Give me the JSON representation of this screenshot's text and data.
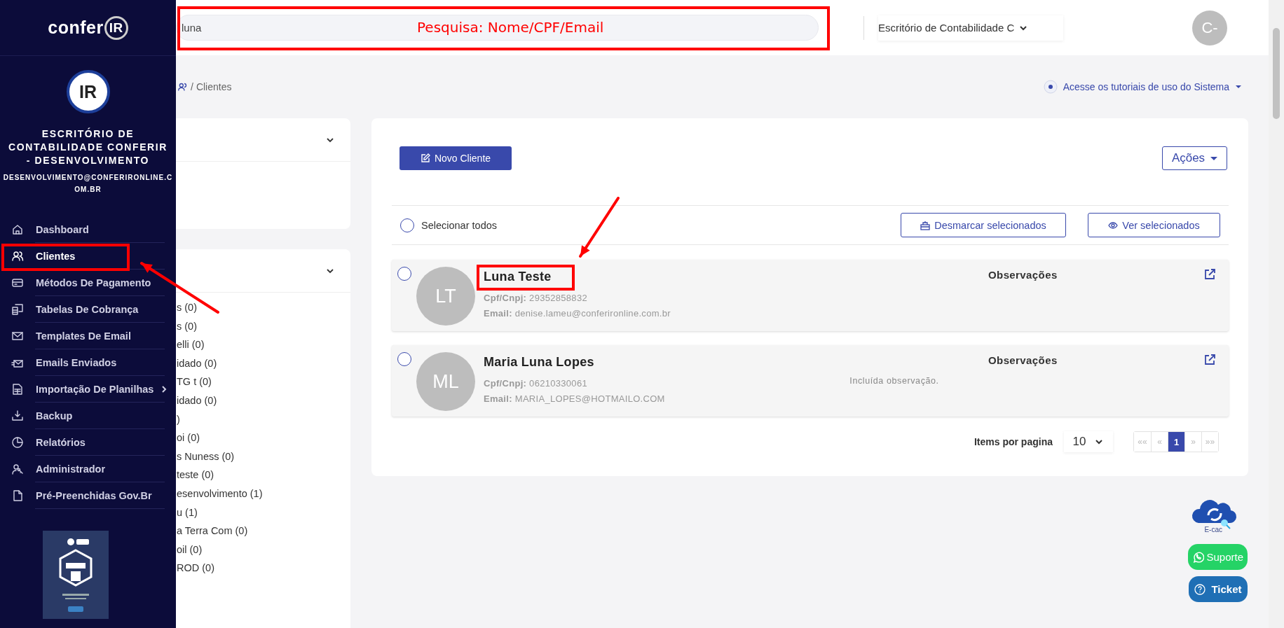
{
  "sidebar": {
    "logo": {
      "text": "confer",
      "mark": "IR"
    },
    "profile_mark": "IR",
    "company": "ESCRITÓRIO DE CONTABILIDADE CONFERIR - DESENVOLVIMENTO",
    "email": "DESENVOLVIMENTO@CONFERIRONLINE.COM.BR",
    "items": [
      {
        "label": "Dashboard",
        "selected": false,
        "has_submenu": false
      },
      {
        "label": "Clientes",
        "selected": true,
        "has_submenu": false
      },
      {
        "label": "Métodos De Pagamento",
        "selected": false,
        "has_submenu": false
      },
      {
        "label": "Tabelas De Cobrança",
        "selected": false,
        "has_submenu": false
      },
      {
        "label": "Templates De Email",
        "selected": false,
        "has_submenu": false
      },
      {
        "label": "Emails Enviados",
        "selected": false,
        "has_submenu": false
      },
      {
        "label": "Importação De Planilhas",
        "selected": false,
        "has_submenu": true
      },
      {
        "label": "Backup",
        "selected": false,
        "has_submenu": false
      },
      {
        "label": "Relatórios",
        "selected": false,
        "has_submenu": false
      },
      {
        "label": "Administrador",
        "selected": false,
        "has_submenu": false
      },
      {
        "label": "Pré-Preenchidas Gov.Br",
        "selected": false,
        "has_submenu": false
      }
    ]
  },
  "topbar": {
    "search": {
      "value": "luna"
    },
    "office": "Escritório de Contabilidade C",
    "avatar": "C-"
  },
  "annotation": {
    "search_label": "Pesquisa: Nome/CPF/Email"
  },
  "breadcrumb": {
    "separator": "/",
    "current": "Clientes"
  },
  "tutorial_link": "Acesse os tutoriais de uso do Sistema",
  "filters": {
    "items": [
      {
        "label": "s (0)"
      },
      {
        "label": "s (0)"
      },
      {
        "label": "elli (0)"
      },
      {
        "label": "idado (0)"
      },
      {
        "label": "TG t (0)"
      },
      {
        "label": "idado (0)"
      },
      {
        "label": ")"
      },
      {
        "label": "oi (0)"
      },
      {
        "label": "s Nuness (0)"
      },
      {
        "label": "teste (0)"
      },
      {
        "label": "esenvolvimento (1)"
      },
      {
        "label": "u (1)"
      },
      {
        "label": "a Terra Com (0)"
      },
      {
        "label": "oil (0)"
      },
      {
        "label": "ROD (0)"
      }
    ]
  },
  "clients": {
    "new_button": "Novo Cliente",
    "actions": "Ações",
    "select_all": "Selecionar todos",
    "select_all_checked": false,
    "unselect_button": "Desmarcar selecionados",
    "view_button": "Ver selecionados",
    "rows": [
      {
        "initials": "LT",
        "name": "Luna Teste",
        "cpf_label": "Cpf/Cnpj:",
        "cpf": "29352858832",
        "email_label": "Email:",
        "email": "denise.lameu@conferironline.com.br",
        "notes_title": "Observações",
        "selected": false
      },
      {
        "initials": "ML",
        "name": "Maria Luna Lopes",
        "cpf_label": "Cpf/Cnpj:",
        "cpf": "06210330061",
        "email_label": "Email:",
        "email": "MARIA_LOPES@HOTMAILO.COM",
        "notes_title": "Observações",
        "note": "Incluída observação.",
        "selected": false
      }
    ],
    "pagination": {
      "label": "Items por pagina",
      "page_size": "10",
      "pages": [
        {
          "label": "««",
          "selected": false
        },
        {
          "label": "«",
          "selected": false
        },
        {
          "label": "1",
          "selected": true
        },
        {
          "label": "»",
          "selected": false
        },
        {
          "label": "»»",
          "selected": false
        }
      ]
    }
  },
  "floating": {
    "ecac": "E-cac",
    "support": "Suporte",
    "ticket": "Ticket"
  }
}
